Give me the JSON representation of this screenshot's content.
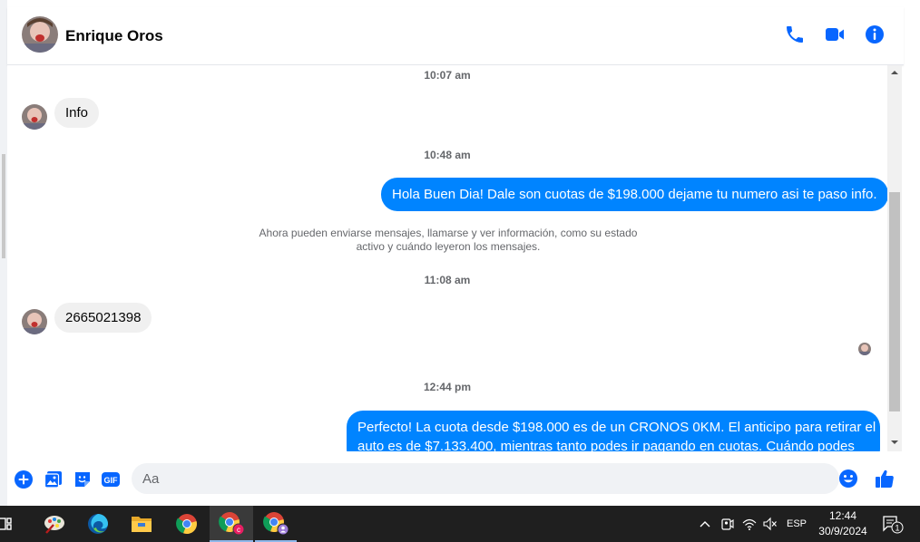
{
  "contact": {
    "name": "Enrique Oros"
  },
  "colors": {
    "accent": "#0084ff",
    "icon_blue": "#0866ff",
    "bubble_incoming": "#f0f0f0",
    "taskbar": "#1f1f1f"
  },
  "header_icons": [
    "phone-icon",
    "video-camera-icon",
    "info-icon"
  ],
  "messages": [
    {
      "type": "timestamp",
      "text": "10:07 am"
    },
    {
      "type": "incoming",
      "text": "Info"
    },
    {
      "type": "timestamp",
      "text": "10:48 am"
    },
    {
      "type": "outgoing",
      "text": "Hola Buen Dia! Dale son cuotas de $198.000 dejame tu numero asi te paso info."
    },
    {
      "type": "notice",
      "line1": "Ahora pueden enviarse mensajes, llamarse y ver información, como su estado",
      "line2": "activo y cuándo leyeron los mensajes."
    },
    {
      "type": "timestamp",
      "text": "11:08 am"
    },
    {
      "type": "incoming",
      "text": "2665021398"
    },
    {
      "type": "timestamp",
      "text": "12:44 pm"
    },
    {
      "type": "outgoing",
      "line1": "Perfecto! La cuota desde $198.000 es de un CRONOS 0KM. El anticipo para retirar el",
      "line2": "auto es de $7.133.400, mientras tanto podes ir pagando en cuotas. Cuándo podes"
    }
  ],
  "composer": {
    "placeholder": "Aa",
    "gif_label": "GIF",
    "icons": [
      "plus-icon",
      "photo-icon",
      "sticker-icon",
      "gif-icon",
      "emoji-icon",
      "thumbs-up-icon"
    ]
  },
  "taskbar": {
    "apps": [
      "task-view-icon",
      "paint-icon",
      "edge-icon",
      "file-explorer-icon",
      "chrome-icon",
      "chrome-profile-c-icon",
      "chrome-profile-person-icon"
    ],
    "profile_badge": "c",
    "language": "ESP",
    "time": "12:44",
    "date": "30/9/2024",
    "notification_count": "1"
  }
}
